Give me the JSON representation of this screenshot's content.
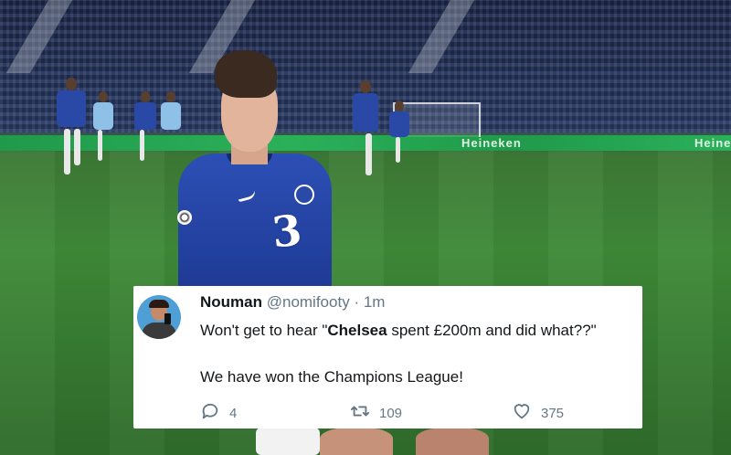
{
  "tweet": {
    "name": "Nouman",
    "handle": "@nomifooty",
    "separator": "·",
    "time": "1m",
    "text_before": "Won't get to hear \"",
    "text_bold": "Chelsea",
    "text_after": " spent £200m and did what??\"",
    "text_line2": "We have won the Champions League!",
    "replies": "4",
    "retweets": "109",
    "likes": "375"
  },
  "photo": {
    "shirt_number": "3",
    "ad_board_left": "Heineken",
    "ad_board_right": "Heineken"
  },
  "colors": {
    "shirt": "#2d4fb5",
    "pitch": "#3f8a38",
    "meta_text": "#657786"
  },
  "icons": [
    "reply-icon",
    "retweet-icon",
    "like-icon"
  ]
}
